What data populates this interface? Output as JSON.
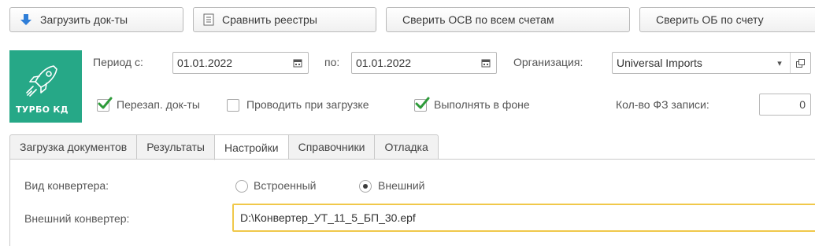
{
  "toolbar": {
    "load_docs": "Загрузить док-ты",
    "compare_registers": "Сравнить реестры",
    "reconcile_all": "Сверить ОСВ по всем счетам",
    "reconcile_account": "Сверить ОБ по счету"
  },
  "logo": {
    "text": "ТУРБО КД",
    "accent": "#26a887"
  },
  "period": {
    "from_label": "Период с:",
    "from_value": "01.01.2022",
    "to_label": "по:",
    "to_value": "01.01.2022"
  },
  "organization": {
    "label": "Организация:",
    "value": "Universal Imports"
  },
  "options": {
    "reload_docs": {
      "label": "Перезап. док-ты",
      "checked": true
    },
    "post_on_load": {
      "label": "Проводить при загрузке",
      "checked": false
    },
    "run_background": {
      "label": "Выполнять в фоне",
      "checked": true
    },
    "fz_count_label": "Кол-во ФЗ записи:",
    "fz_count_value": "0"
  },
  "tabs": [
    {
      "label": "Загрузка документов",
      "active": false
    },
    {
      "label": "Результаты",
      "active": false
    },
    {
      "label": "Настройки",
      "active": true
    },
    {
      "label": "Справочники",
      "active": false
    },
    {
      "label": "Отладка",
      "active": false
    }
  ],
  "settings": {
    "converter_type_label": "Вид конвертера:",
    "builtin_label": "Встроенный",
    "external_label": "Внешний",
    "selected": "Внешний",
    "external_converter_label": "Внешний конвертер:",
    "external_converter_value": "D:\\Конвертер_УТ_11_5_БП_30.epf"
  }
}
